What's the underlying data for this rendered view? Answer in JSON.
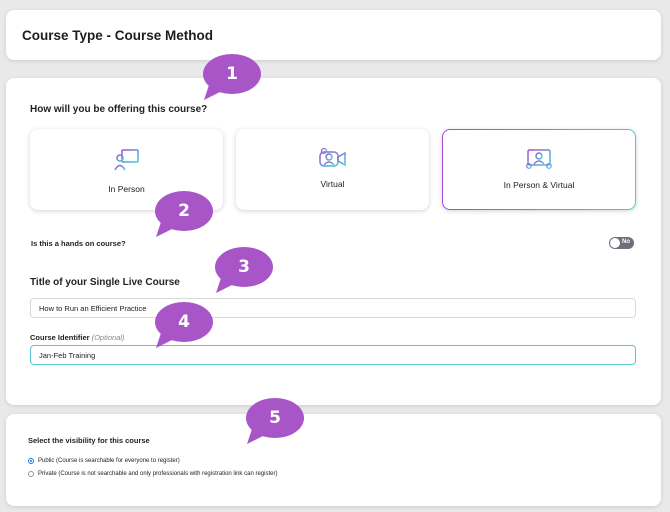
{
  "header": {
    "title": "Course Type - Course Method"
  },
  "offering": {
    "question": "How will you be offering this course?",
    "options": [
      {
        "label": "In Person",
        "icon": "presenter-icon",
        "selected": false
      },
      {
        "label": "Virtual",
        "icon": "video-call-icon",
        "selected": false
      },
      {
        "label": "In Person & Virtual",
        "icon": "in-person-virtual-icon",
        "selected": true
      }
    ]
  },
  "hands_on": {
    "label": "Is this a hands on course?",
    "toggle_text": "No"
  },
  "course": {
    "section_title": "Title of your Single Live Course",
    "title_value": "How to Run an Efficient Practice",
    "identifier_label": "Course Identifier",
    "identifier_optional": "(Optional)",
    "identifier_value": "Jan-Feb Training"
  },
  "visibility": {
    "title": "Select the visibility for this course",
    "options": [
      {
        "label": "Public (Course is searchable for everyone to register)",
        "checked": true
      },
      {
        "label": "Private (Course is not searchable and only professionals with registration link can register)",
        "checked": false
      }
    ]
  },
  "callouts": [
    "1",
    "2",
    "3",
    "4",
    "5"
  ],
  "colors": {
    "accent_purple": "#a34bd6",
    "accent_teal": "#3fd0d8",
    "callout": "#a855c8",
    "radio_blue": "#1f6fe5"
  }
}
